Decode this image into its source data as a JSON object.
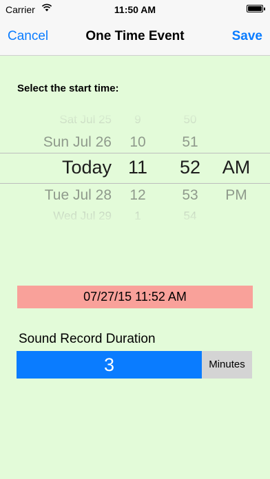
{
  "status_bar": {
    "carrier": "Carrier",
    "time": "11:50 AM"
  },
  "nav": {
    "cancel_label": "Cancel",
    "title": "One Time Event",
    "save_label": "Save"
  },
  "picker": {
    "label": "Select the start time:",
    "date_column": [
      "Sat Jul 25",
      "Sun Jul 26",
      "Today",
      "Tue Jul 28",
      "Wed Jul 29"
    ],
    "hour_column": [
      "9",
      "10",
      "11",
      "12",
      "1"
    ],
    "minute_column": [
      "50",
      "51",
      "52",
      "53",
      "54"
    ],
    "ampm_column": [
      "",
      "",
      "AM",
      "PM",
      ""
    ],
    "selected": {
      "date": "Today",
      "hour": "11",
      "minute": "52",
      "ampm": "AM"
    }
  },
  "selected_datetime": "07/27/15 11:52 AM",
  "duration": {
    "label": "Sound Record Duration",
    "value": "3",
    "unit": "Minutes"
  },
  "colors": {
    "background": "#e3fbd9",
    "accent": "#0a7cff",
    "date_highlight": "#f9a19a",
    "unit_bg": "#d4d4d4"
  }
}
